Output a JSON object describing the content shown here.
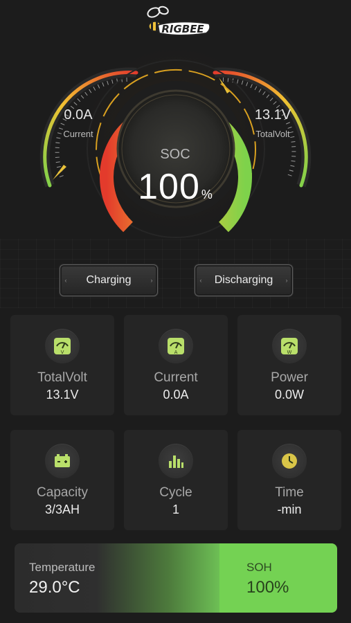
{
  "brand": {
    "logo_text": "RIGBEE"
  },
  "gauges": {
    "current": {
      "value": "0.0A",
      "label": "Current"
    },
    "total_volt": {
      "value": "13.1V",
      "label": "TotalVolt"
    },
    "soc": {
      "label": "SOC",
      "value": "100",
      "unit": "%",
      "level": 1.0
    }
  },
  "mode_buttons": {
    "charging": "Charging",
    "discharging": "Discharging"
  },
  "cards": [
    {
      "label": "TotalVolt",
      "value": "13.1V",
      "icon": "voltmeter-icon"
    },
    {
      "label": "Current",
      "value": "0.0A",
      "icon": "ammeter-icon"
    },
    {
      "label": "Power",
      "value": "0.0W",
      "icon": "wattmeter-icon"
    },
    {
      "label": "Capacity",
      "value": "3/3AH",
      "icon": "battery-icon"
    },
    {
      "label": "Cycle",
      "value": "1",
      "icon": "bar-chart-icon"
    },
    {
      "label": "Time",
      "value": "-min",
      "icon": "clock-icon"
    }
  ],
  "temperature": {
    "label": "Temperature",
    "value": "29.0°C"
  },
  "soh": {
    "label": "SOH",
    "value": "100%"
  },
  "colors": {
    "accent_green": "#74d253",
    "gauge_red": "#e33b2c",
    "gauge_yellow": "#f2c132",
    "gauge_green": "#7ed24b",
    "background": "#1c1c1c"
  }
}
